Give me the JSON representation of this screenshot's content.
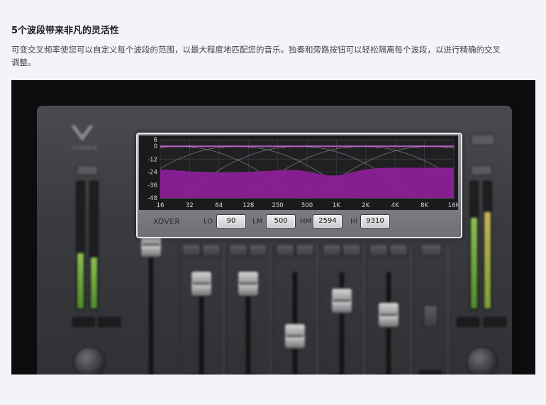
{
  "article": {
    "heading": "5个波段带来非凡的灵活性",
    "description": "可变交叉频率使您可以自定义每个波段的范围，以最大程度地匹配您的音乐。独奏和旁路按钮可以轻松隔离每个波段，以进行精确的交叉调整。"
  },
  "plugin": {
    "brand": "VITAMIN",
    "eq_graph": {
      "y_ticks": [
        "6",
        "0",
        "-12",
        "-24",
        "-36",
        "-48"
      ],
      "x_ticks": [
        "16",
        "32",
        "64",
        "128",
        "250",
        "500",
        "1K",
        "2K",
        "4K",
        "8K",
        "16K"
      ],
      "y_range": [
        -48,
        6
      ]
    },
    "crossover": {
      "title": "XOVER",
      "bands": [
        {
          "label": "LO",
          "value": "90"
        },
        {
          "label": "LM",
          "value": "500"
        },
        {
          "label": "HM",
          "value": "2594"
        },
        {
          "label": "HI",
          "value": "9310"
        }
      ]
    }
  },
  "colors": {
    "graph_fill": "#8e1e9a",
    "graph_line": "#d86fe0",
    "meter_green": "#7fb046"
  }
}
